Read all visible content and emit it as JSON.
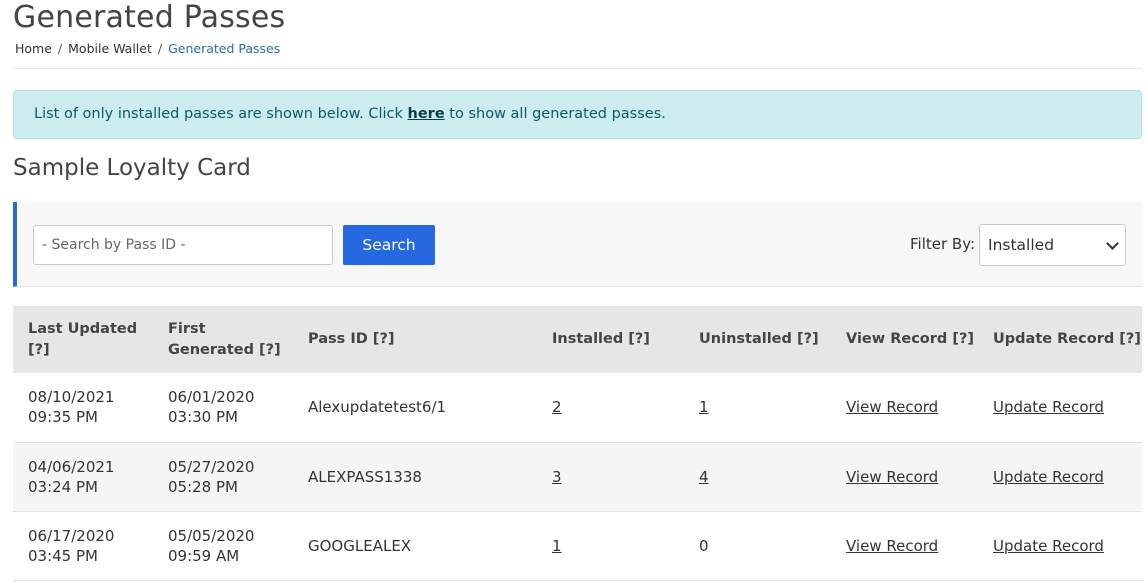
{
  "page": {
    "title": "Generated Passes",
    "breadcrumb": [
      "Home",
      "Mobile Wallet",
      "Generated Passes"
    ],
    "alert": {
      "before": "List of only installed passes are shown below. Click ",
      "link": "here",
      "after": " to show all generated passes."
    },
    "section_title": "Sample Loyalty Card"
  },
  "filters": {
    "search_placeholder": "- Search by Pass ID -",
    "search_button": "Search",
    "filter_label": "Filter By:",
    "filter_value": "Installed"
  },
  "table": {
    "headers": [
      "Last Updated [?]",
      "First Generated [?]",
      "Pass ID [?]",
      "Installed [?]",
      "Uninstalled [?]",
      "View Record [?]",
      "Update Record [?]"
    ],
    "rows": [
      {
        "last_date": "08/10/2021",
        "last_time": "09:35 PM",
        "first_date": "06/01/2020",
        "first_time": "03:30 PM",
        "pass_id": "Alexupdatetest6/1",
        "installed": "2",
        "uninstalled": "1",
        "view": "View Record",
        "update": "Update Record"
      },
      {
        "last_date": "04/06/2021",
        "last_time": "03:24 PM",
        "first_date": "05/27/2020",
        "first_time": "05:28 PM",
        "pass_id": "ALEXPASS1338",
        "installed": "3",
        "uninstalled": "4",
        "view": "View Record",
        "update": "Update Record"
      },
      {
        "last_date": "06/17/2020",
        "last_time": "03:45 PM",
        "first_date": "05/05/2020",
        "first_time": "09:59 AM",
        "pass_id": "GOOGLEALEX",
        "installed": "1",
        "uninstalled": "0",
        "view": "View Record",
        "update": "Update Record"
      }
    ]
  },
  "colors": {
    "accent": "#2469e0",
    "alert_bg": "#cdecf0",
    "header_bg": "#e6e6e6"
  }
}
